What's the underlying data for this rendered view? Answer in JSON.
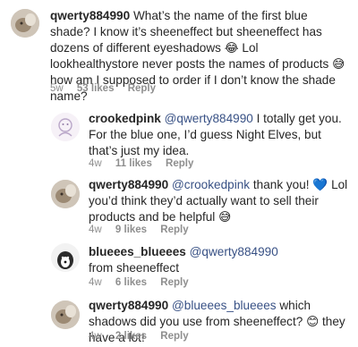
{
  "comments": [
    {
      "username": "qwerty884990",
      "mention": "",
      "text": "What’s the name of the first blue shade? I know it’s sheeneffect but sheeneffect has dozens of different eyeshadows 😂 Lol lookhealthystore never posts the names of products 😅 how am I supposed to order if I don’t know the shade name?",
      "age": "5w",
      "likes": "53 likes",
      "reply": "Reply"
    },
    {
      "username": "crookedpink",
      "mention": "@qwerty884990",
      "text": "I totally get you. For the blue one, I’d guess Night Elves, but that’s just my idea.",
      "age": "4w",
      "likes": "11 likes",
      "reply": "Reply"
    },
    {
      "username": "qwerty884990",
      "mention": "@crookedpink",
      "text": "thank you! 💙 Lol you’d think they’d actually want to sell their products and be helpful 😅",
      "age": "4w",
      "likes": "9 likes",
      "reply": "Reply"
    },
    {
      "username": "blueees_blueees",
      "mention": "@qwerty884990",
      "text": "from sheeneffect",
      "age": "4w",
      "likes": "6 likes",
      "reply": "Reply"
    },
    {
      "username": "qwerty884990",
      "mention": "@blueees_blueees",
      "text": "which shadows did you use from sheeneffect? 😊 they have a lot!",
      "age": "4w",
      "likes": "2 likes",
      "reply": "Reply"
    }
  ]
}
